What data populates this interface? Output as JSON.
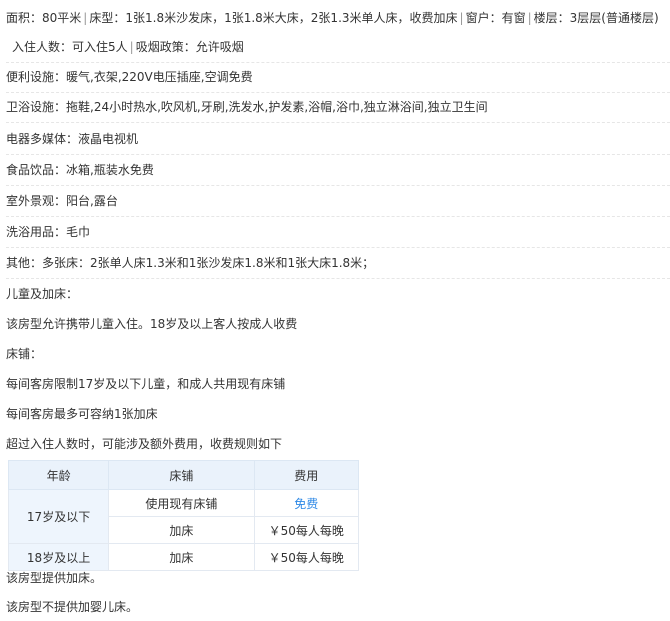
{
  "summary": {
    "area_label": "面积：",
    "area_value": "80平米",
    "bed_label": "床型：",
    "bed_value": "1张1.8米沙发床，1张1.8米大床，2张1.3米单人床，收费加床",
    "window_label": "窗户：",
    "window_value": "有窗",
    "floor_label": "楼层：",
    "floor_value": "3层层(普通楼层)",
    "occupancy_label": "入住人数：",
    "occupancy_value": "可入住5人",
    "smoking_label": "吸烟政策：",
    "smoking_value": "允许吸烟"
  },
  "facilities": [
    {
      "label": "便利设施：",
      "value": "暖气,衣架,220V电压插座,空调免费"
    },
    {
      "label": "卫浴设施：",
      "value": "拖鞋,24小时热水,吹风机,牙刷,洗发水,护发素,浴帽,浴巾,独立淋浴间,独立卫生间"
    },
    {
      "label": "电器多媒体：",
      "value": "液晶电视机"
    },
    {
      "label": "食品饮品：",
      "value": "冰箱,瓶装水免费"
    },
    {
      "label": "室外景观：",
      "value": "阳台,露台"
    },
    {
      "label": "洗浴用品：",
      "value": "毛巾"
    },
    {
      "label": "其他：",
      "value": "多张床：2张单人床1.3米和1张沙发床1.8米和1张大床1.8米；"
    }
  ],
  "children_policy": {
    "title": "儿童及加床：",
    "text1": "该房型允许携带儿童入住。18岁及以上客人按成人收费",
    "bed_title": "床铺：",
    "text2": "每间客房限制17岁及以下儿童，和成人共用现有床铺",
    "text3": "每间客房最多可容纳1张加床",
    "text4": "超过入住人数时，可能涉及额外费用，收费规则如下"
  },
  "fee_table": {
    "headers": [
      "年龄",
      "床铺",
      "费用"
    ],
    "group1_age": "17岁及以下",
    "group1_rows": [
      {
        "bed": "使用现有床铺",
        "fee": "免费"
      },
      {
        "bed": "加床",
        "fee": "￥50每人每晚"
      }
    ],
    "group2_age": "18岁及以上",
    "group2_row": {
      "bed": "加床",
      "fee": "￥50每人每晚"
    }
  },
  "footer": {
    "extra_bed": "该房型提供加床。",
    "crib": "该房型不提供加婴儿床。"
  },
  "colors": {
    "free_text": "#2d88e6",
    "header_bg": "#eaf2fb"
  }
}
